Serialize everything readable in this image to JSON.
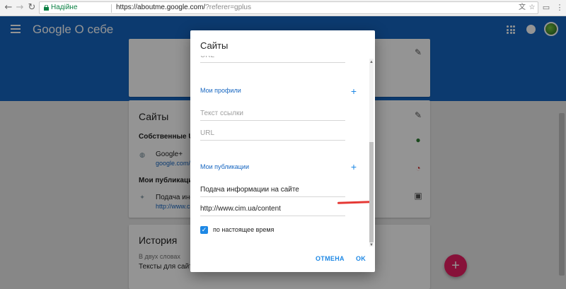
{
  "browser": {
    "secure_label": "Надійне",
    "url_main": "https://aboutme.google.com/",
    "url_tail": "?referer=gplus",
    "icons": [
      "back-icon",
      "forward-icon",
      "reload-icon",
      "translate-icon",
      "star-icon",
      "cast-icon",
      "menu-icon"
    ]
  },
  "app": {
    "title": "Google О себе",
    "accent_color": "#1565c0"
  },
  "background": {
    "sites_card": {
      "title": "Сайты",
      "own_urls_label": "Собственные URL",
      "google_plus_label": "Google+",
      "google_plus_link": "google.com/+",
      "publications_label": "Мои публикации",
      "publication_text": "Подача инфо",
      "publication_link": "http://www.ci"
    },
    "history_card": {
      "title": "История",
      "summary_label": "В двух словах",
      "summary_text": "Тексты для сайт"
    }
  },
  "dialog": {
    "title": "Сайты",
    "url_placeholder_top": "URL",
    "profiles_label": "Мои профили",
    "link_text_placeholder": "Текст ссылки",
    "url_placeholder": "URL",
    "publications_label": "Мои публикации",
    "publication_title": "Подача информации на сайте",
    "publication_url": "http://www.cim.ua/content",
    "checkbox_label": "по настоящее время",
    "checkbox_checked": true,
    "cancel_label": "ОТМЕНА",
    "ok_label": "OK"
  }
}
